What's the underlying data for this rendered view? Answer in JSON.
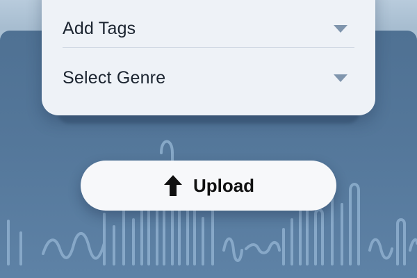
{
  "form": {
    "tags_label": "Add Tags",
    "genre_label": "Select Genre"
  },
  "upload": {
    "label": "Upload",
    "icon": "arrow-up-icon"
  },
  "colors": {
    "backdrop": "#54779a",
    "card": "#eef2f7",
    "button": "#f7f8fa",
    "caret": "#7f95ad",
    "waveform": "#8fb0cf"
  }
}
